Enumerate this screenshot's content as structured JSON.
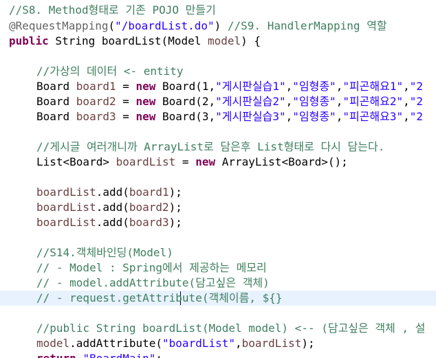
{
  "editor": {
    "colors": {
      "comment": "#3f7f5f",
      "annotation": "#646464",
      "string": "#2a00ff",
      "keyword": "#7f0055",
      "local_variable": "#6a3e3e",
      "current_line": "#e8f2fe"
    },
    "lines": [
      {
        "comment": "//S8. Method형태로 기존 POJO 만들기"
      },
      {
        "annotation": "@RequestMapping",
        "p1": "(",
        "url": "\"/boardList.do\"",
        "p2": ") ",
        "comment": "//S9. HandlerMapping 역할"
      },
      {
        "kw_public": "public",
        "p1": " String boardList(Model ",
        "var_model": "model",
        "p2": ") {"
      },
      {},
      {
        "comment": "//가상의 데이터 <- entity"
      },
      {
        "p1": "Board ",
        "var": "board1",
        "p2": " = ",
        "kw_new": "new",
        "p3": " Board(1,",
        "s1": "\"게시판실습1\"",
        "p4": ",",
        "s2": "\"임형종\"",
        "p5": ",",
        "s3": "\"피곤해요1\"",
        "p6": ",",
        "s4": "\"2"
      },
      {
        "p1": "Board ",
        "var": "board2",
        "p2": " = ",
        "kw_new": "new",
        "p3": " Board(2,",
        "s1": "\"게시판실습2\"",
        "p4": ",",
        "s2": "\"임형종\"",
        "p5": ",",
        "s3": "\"피곤해요2\"",
        "p6": ",",
        "s4": "\"2"
      },
      {
        "p1": "Board ",
        "var": "board3",
        "p2": " = ",
        "kw_new": "new",
        "p3": " Board(3,",
        "s1": "\"게시판실습3\"",
        "p4": ",",
        "s2": "\"임형종\"",
        "p5": ",",
        "s3": "\"피곤해요3\"",
        "p6": ",",
        "s4": "\"2"
      },
      {},
      {
        "comment": "//게시글 여러개니까 ArrayList로 담은후 List형태로 다시 담는다."
      },
      {
        "p1": "List<Board> ",
        "var": "boardList",
        "p2": " = ",
        "kw_new": "new",
        "p3": " ArrayList<Board>();"
      },
      {},
      {
        "var": "boardList",
        "p1": ".add(",
        "var2": "board1",
        "p2": ");"
      },
      {
        "var": "boardList",
        "p1": ".add(",
        "var2": "board2",
        "p2": ");"
      },
      {
        "var": "boardList",
        "p1": ".add(",
        "var2": "board3",
        "p2": ");"
      },
      {},
      {
        "comment": "//S14.객체바인딩(Model)"
      },
      {
        "comment": "// - Model : Spring에서 제공하는 메모리"
      },
      {
        "comment": "// - model.addAttribute(담고싶은 객체)"
      },
      {
        "comment": "// - request.getAttribute(객체이름, ${}"
      },
      {},
      {
        "comment": "//public String boardList(Model model) <-- (담고싶은 객체 , 설"
      },
      {
        "var": "model",
        "p1": ".addAttribute(",
        "s1": "\"boardList\"",
        "p2": ",",
        "var2": "boardList",
        "p3": ");"
      },
      {
        "kw_return": "return",
        "p1": " ",
        "s1": "\"BoardMain\"",
        "p2": ";"
      }
    ]
  }
}
